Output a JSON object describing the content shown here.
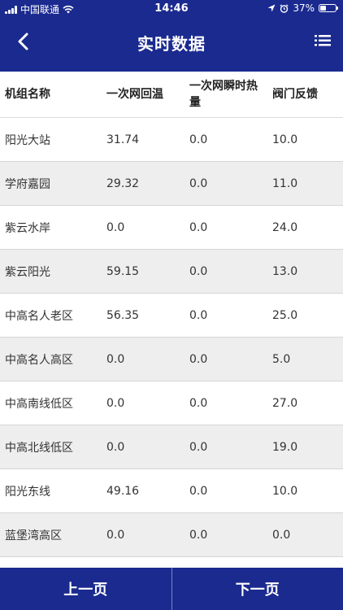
{
  "status_bar": {
    "carrier": "中国联通",
    "time": "14:46",
    "battery": "37%",
    "battery_level": 0.37
  },
  "nav": {
    "title": "实时数据"
  },
  "table": {
    "headers": [
      "机组名称",
      "一次网回温",
      "一次网瞬时热量",
      "阀门反馈"
    ],
    "rows": [
      [
        "阳光大站",
        "31.74",
        "0.0",
        "10.0"
      ],
      [
        "学府嘉园",
        "29.32",
        "0.0",
        "11.0"
      ],
      [
        "紫云水岸",
        "0.0",
        "0.0",
        "24.0"
      ],
      [
        "紫云阳光",
        "59.15",
        "0.0",
        "13.0"
      ],
      [
        "中高名人老区",
        "56.35",
        "0.0",
        "25.0"
      ],
      [
        "中高名人高区",
        "0.0",
        "0.0",
        "5.0"
      ],
      [
        "中高南线低区",
        "0.0",
        "0.0",
        "27.0"
      ],
      [
        "中高北线低区",
        "0.0",
        "0.0",
        "19.0"
      ],
      [
        "阳光东线",
        "49.16",
        "0.0",
        "10.0"
      ],
      [
        "蓝堡湾高区",
        "0.0",
        "0.0",
        "0.0"
      ],
      [
        "",
        "",
        "",
        ""
      ]
    ]
  },
  "footer": {
    "prev_label": "上一页",
    "next_label": "下一页"
  },
  "colors": {
    "primary": "#1a2a8f",
    "row_alt": "#eeeeee"
  }
}
